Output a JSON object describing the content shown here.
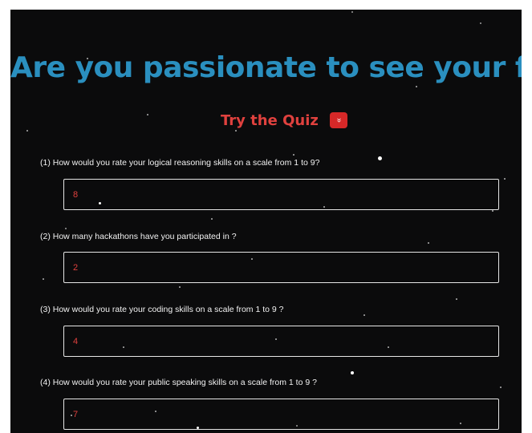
{
  "page": {
    "title": "Are you passionate to see your future ?",
    "cta_label": "Try the Quiz",
    "cta_icon": "chevron-down-icon",
    "cta_icon_glyph": "»"
  },
  "colors": {
    "background": "#0b0b0c",
    "title": "#2a8fbf",
    "accent": "#e0413e",
    "button": "#d62828"
  },
  "questions": [
    {
      "label": "(1) How would you rate your logical reasoning skills on a scale from 1 to 9?",
      "value": "8"
    },
    {
      "label": "(2) How many hackathons have you participated in ?",
      "value": "2"
    },
    {
      "label": "(3) How would you rate your coding skills on a scale from 1 to 9 ?",
      "value": "4"
    },
    {
      "label": "(4) How would you rate your public speaking skills on a scale from 1 to 9 ?",
      "value": "7"
    }
  ]
}
